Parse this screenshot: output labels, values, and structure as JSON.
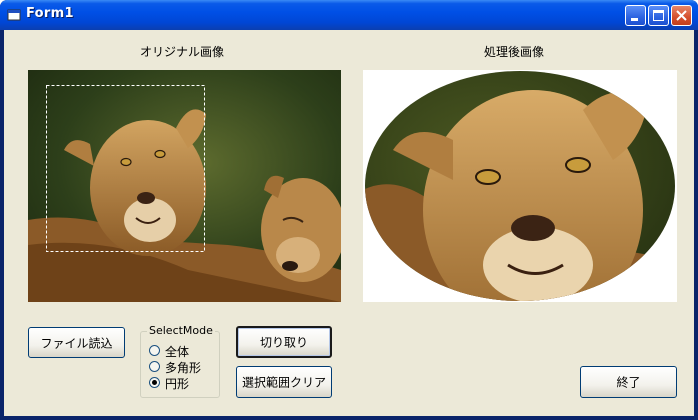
{
  "window": {
    "title": "Form1"
  },
  "labels": {
    "original": "オリジナル画像",
    "processed": "処理後画像"
  },
  "buttons": {
    "load_file": "ファイル読込",
    "crop": "切り取り",
    "clear_selection": "選択範囲クリア",
    "exit": "終了"
  },
  "select_mode": {
    "label": "SelectMode",
    "options": [
      "全体",
      "多角形",
      "円形"
    ],
    "selected": "円形"
  }
}
